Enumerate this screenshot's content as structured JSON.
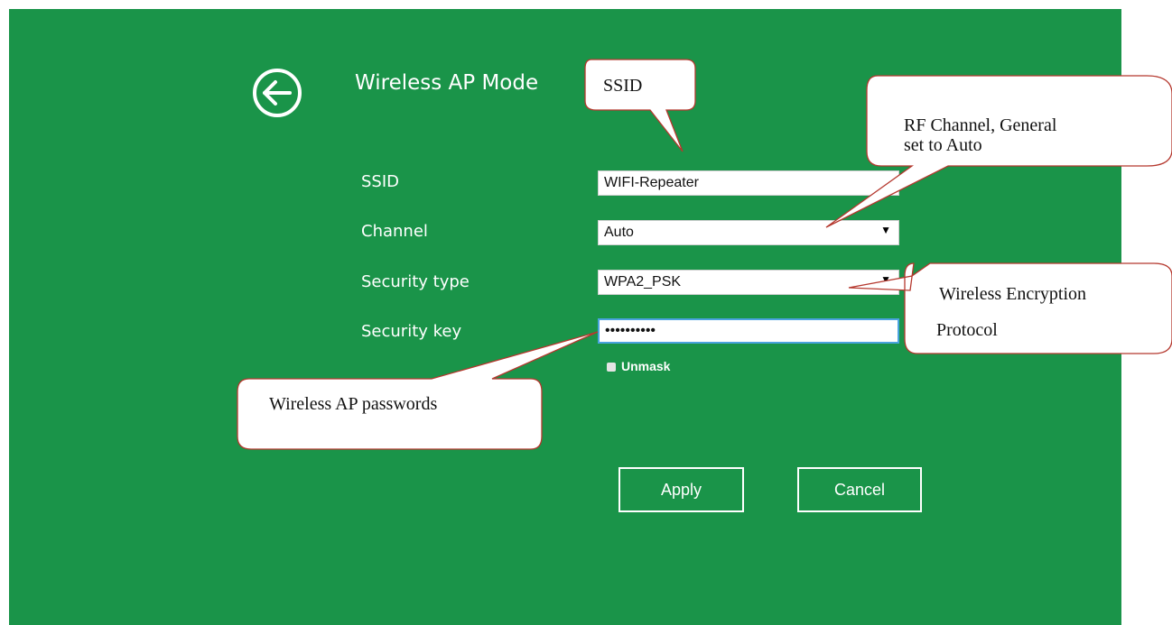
{
  "header": {
    "title": "Wireless AP Mode",
    "back_icon": "arrow-left-circle-icon"
  },
  "form": {
    "ssid_label": "SSID",
    "ssid_value": "WIFI-Repeater",
    "channel_label": "Channel",
    "channel_value": "Auto",
    "security_type_label": "Security type",
    "security_type_value": "WPA2_PSK",
    "security_key_label": "Security key",
    "security_key_value": "••••••••••",
    "key_length": "10",
    "unmask_label": "Unmask"
  },
  "buttons": {
    "apply_label": "Apply",
    "cancel_label": "Cancel"
  },
  "annotations": {
    "ssid": "SSID",
    "rf_channel_line1": "RF  Channel,  General",
    "rf_channel_line2": "set to Auto",
    "encryption_line1": "Wireless Encryption",
    "encryption_line2": "Protocol",
    "ap_password": "Wireless AP passwords"
  },
  "colors": {
    "panel_bg": "#1a9449",
    "callout_stroke": "#b5382e",
    "field_focus_border": "#4aa3df"
  }
}
